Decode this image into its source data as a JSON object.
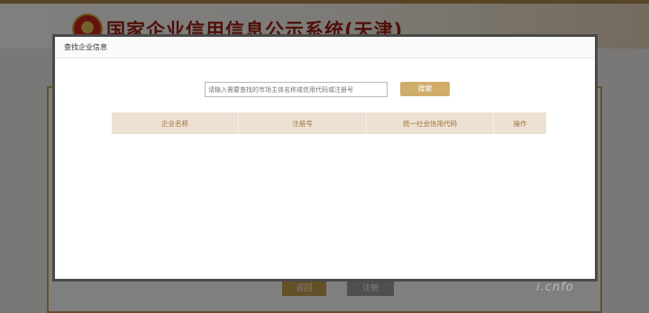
{
  "site": {
    "title": "国家企业信用信息公示系统(天津)"
  },
  "background_buttons": {
    "back": "返回",
    "register": "注册"
  },
  "watermark": "i.cnfo",
  "dialog": {
    "title": "查找企业信息",
    "search": {
      "placeholder": "请输入需要查找的市场主体名称或信用代码或注册号",
      "value": "",
      "button_label": "搜索"
    },
    "table": {
      "columns": [
        "企业名称",
        "注册号",
        "统一社会信用代码",
        "操作"
      ],
      "rows": []
    }
  },
  "colors": {
    "accent_gold": "#d0ad6a",
    "title_red": "#9e1f14",
    "table_header_bg": "#ece1d2",
    "table_header_text": "#a0743f"
  }
}
